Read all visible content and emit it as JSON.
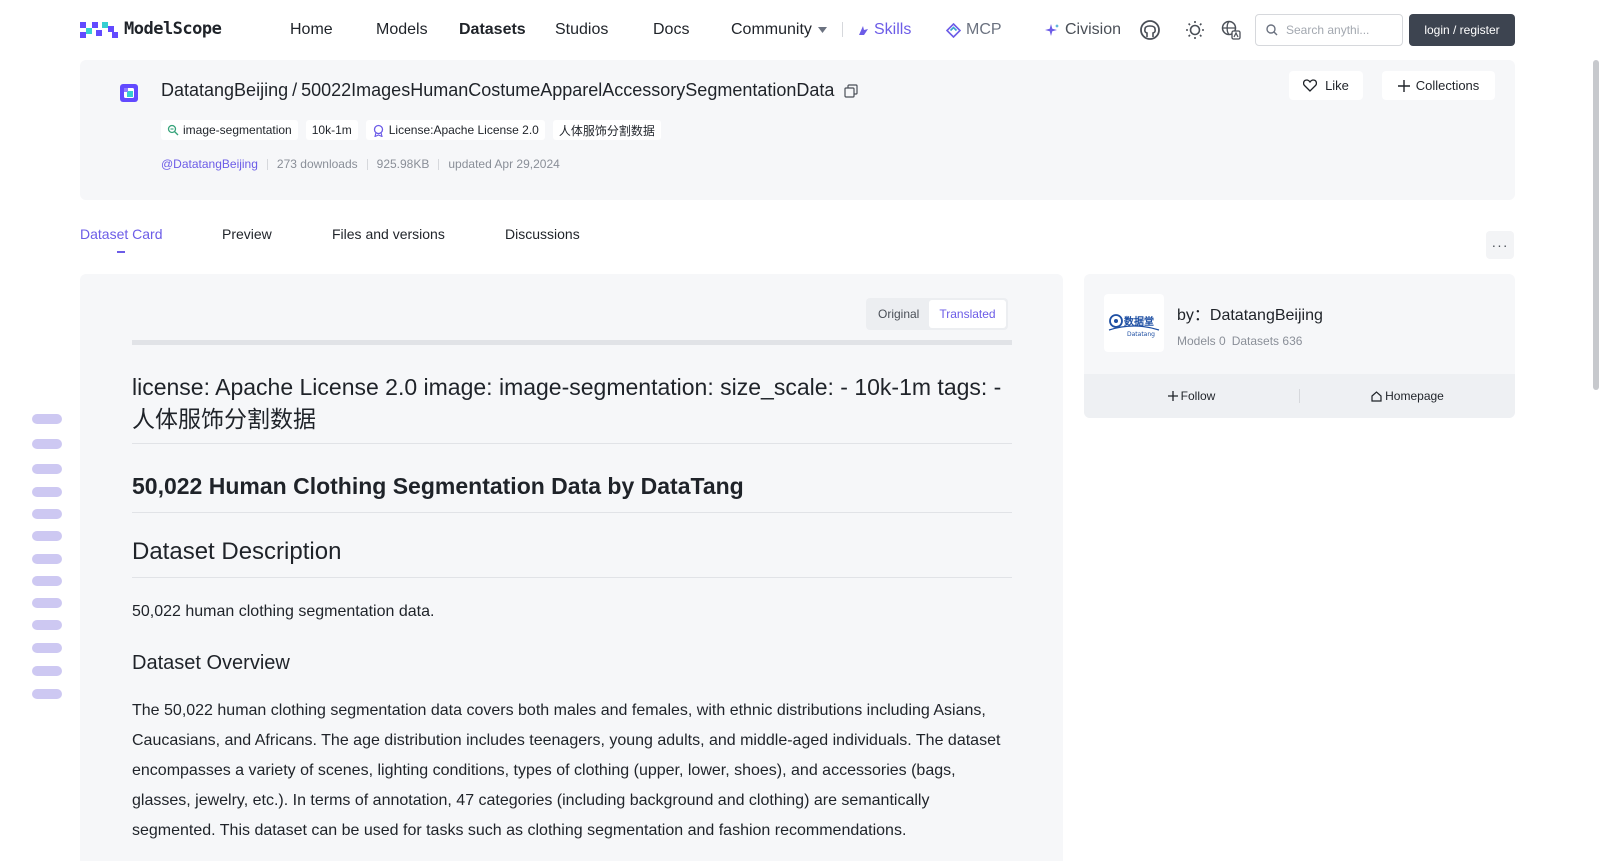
{
  "brand": {
    "name": "ModelScope"
  },
  "nav": {
    "home": "Home",
    "models": "Models",
    "datasets": "Datasets",
    "studios": "Studios",
    "docs": "Docs",
    "community": "Community",
    "skills": "Skills",
    "mcp": "MCP",
    "civision": "Civision"
  },
  "search": {
    "placeholder": "Search anythi..."
  },
  "login": {
    "label": "login / register"
  },
  "dataset": {
    "owner": "DatatangBeijing",
    "slash": "/",
    "name": "50022ImagesHumanCostumeApparelAccessorySegmentationData",
    "tags": [
      "image-segmentation",
      "10k-1m",
      "License:Apache License 2.0",
      "人体服饰分割数据"
    ],
    "author": "@DatatangBeijing",
    "downloads": "273 downloads",
    "size": "925.98KB",
    "updated": "updated Apr 29,2024"
  },
  "actions": {
    "like": "Like",
    "collections": "Collections"
  },
  "tabs": [
    "Dataset Card",
    "Preview",
    "Files and versions",
    "Discussions"
  ],
  "toggle": {
    "original": "Original",
    "translated": "Translated"
  },
  "card": {
    "yaml": "license: Apache License 2.0 image: image-segmentation: size_scale: - 10k-1m tags: - 人体服饰分割数据",
    "h1": "50,022 Human Clothing Segmentation Data by DataTang",
    "h2": "Dataset Description",
    "p1": "50,022 human clothing segmentation data.",
    "h3": "Dataset Overview",
    "p2": "The 50,022 human clothing segmentation data covers both males and females, with ethnic distributions including Asians, Caucasians, and Africans. The age distribution includes teenagers, young adults, and middle-aged individuals. The dataset encompasses a variety of scenes, lighting conditions, types of clothing (upper, lower, shoes), and accessories (bags, glasses, jewelry, etc.). In terms of annotation, 47 categories (including background and clothing) are semantically segmented. This dataset can be used for tasks such as clothing segmentation and fashion recommendations."
  },
  "org": {
    "by": "by：DatatangBeijing",
    "models": "Models 0",
    "datasets": "Datasets 636",
    "logo_text": "数据堂",
    "logo_sub": "Datatang",
    "follow": "Follow",
    "homepage": "Homepage"
  },
  "colors": {
    "accent": "#6c5ce7",
    "dark_button": "#3d4450",
    "panel": "#f6f7f9"
  }
}
